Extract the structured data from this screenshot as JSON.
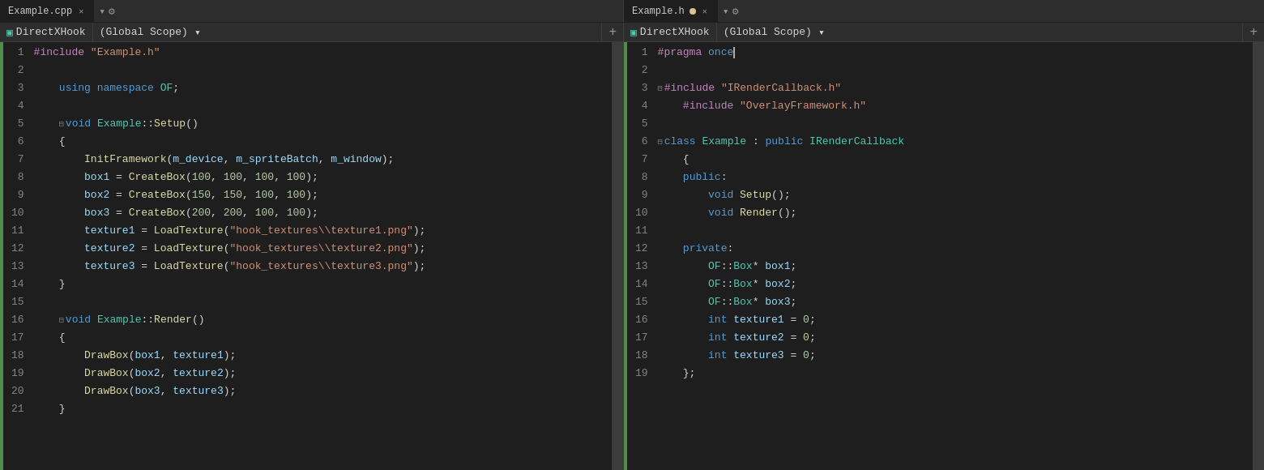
{
  "tabs": {
    "left": {
      "items": [
        {
          "id": "example-cpp",
          "label": "Example.cpp",
          "active": false,
          "modified": false,
          "closable": true
        },
        {
          "id": "settings-gear",
          "label": "⚙",
          "active": false
        }
      ],
      "active_tab": "example-cpp",
      "scope_label": "DirectXHook",
      "scope_select": "(Global Scope)",
      "plus_label": "+"
    },
    "right": {
      "items": [
        {
          "id": "example-h",
          "label": "Example.h",
          "active": true,
          "modified": true,
          "closable": true
        }
      ],
      "scope_label": "DirectXHook",
      "scope_select": "(Global Scope)",
      "plus_label": "+"
    }
  },
  "left_panel": {
    "lines": [
      {
        "num": 1,
        "code": "#include \"Example.h\"",
        "type": "include"
      },
      {
        "num": 2,
        "code": "",
        "type": "blank"
      },
      {
        "num": 3,
        "code": "    using namespace OF;",
        "type": "code"
      },
      {
        "num": 4,
        "code": "",
        "type": "blank"
      },
      {
        "num": 5,
        "code": "    −void Example::Setup()",
        "type": "code"
      },
      {
        "num": 6,
        "code": "    {",
        "type": "code"
      },
      {
        "num": 7,
        "code": "        InitFramework(m_device, m_spriteBatch, m_window);",
        "type": "code"
      },
      {
        "num": 8,
        "code": "        box1 = CreateBox(100, 100, 100, 100);",
        "type": "code"
      },
      {
        "num": 9,
        "code": "        box2 = CreateBox(150, 150, 100, 100);",
        "type": "code"
      },
      {
        "num": 10,
        "code": "        box3 = CreateBox(200, 200, 100, 100);",
        "type": "code"
      },
      {
        "num": 11,
        "code": "        texture1 = LoadTexture(\"hook_textures\\\\texture1.png\");",
        "type": "code"
      },
      {
        "num": 12,
        "code": "        texture2 = LoadTexture(\"hook_textures\\\\texture2.png\");",
        "type": "code"
      },
      {
        "num": 13,
        "code": "        texture3 = LoadTexture(\"hook_textures\\\\texture3.png\");",
        "type": "code"
      },
      {
        "num": 14,
        "code": "    }",
        "type": "code"
      },
      {
        "num": 15,
        "code": "",
        "type": "blank"
      },
      {
        "num": 16,
        "code": "    −void Example::Render()",
        "type": "code"
      },
      {
        "num": 17,
        "code": "    {",
        "type": "code"
      },
      {
        "num": 18,
        "code": "        DrawBox(box1, texture1);",
        "type": "code"
      },
      {
        "num": 19,
        "code": "        DrawBox(box2, texture2);",
        "type": "code"
      },
      {
        "num": 20,
        "code": "        DrawBox(box3, texture3);",
        "type": "code"
      },
      {
        "num": 21,
        "code": "    }",
        "type": "code"
      }
    ]
  },
  "right_panel": {
    "lines": [
      {
        "num": 1,
        "code": "#pragma once",
        "type": "pragma"
      },
      {
        "num": 2,
        "code": "",
        "type": "blank"
      },
      {
        "num": 3,
        "code": "−#include \"IRenderCallback.h\"",
        "type": "include"
      },
      {
        "num": 4,
        "code": "    #include \"OverlayFramework.h\"",
        "type": "include"
      },
      {
        "num": 5,
        "code": "",
        "type": "blank"
      },
      {
        "num": 6,
        "code": "−class Example : public IRenderCallback",
        "type": "class"
      },
      {
        "num": 7,
        "code": "    {",
        "type": "code"
      },
      {
        "num": 8,
        "code": "    public:",
        "type": "code"
      },
      {
        "num": 9,
        "code": "        void Setup();",
        "type": "code"
      },
      {
        "num": 10,
        "code": "        void Render();",
        "type": "code"
      },
      {
        "num": 11,
        "code": "",
        "type": "blank"
      },
      {
        "num": 12,
        "code": "    private:",
        "type": "code"
      },
      {
        "num": 13,
        "code": "        OF::Box* box1;",
        "type": "code"
      },
      {
        "num": 14,
        "code": "        OF::Box* box2;",
        "type": "code"
      },
      {
        "num": 15,
        "code": "        OF::Box* box3;",
        "type": "code"
      },
      {
        "num": 16,
        "code": "        int texture1 = 0;",
        "type": "code"
      },
      {
        "num": 17,
        "code": "        int texture2 = 0;",
        "type": "code"
      },
      {
        "num": 18,
        "code": "        int texture3 = 0;",
        "type": "code"
      },
      {
        "num": 19,
        "code": "    };",
        "type": "code"
      }
    ]
  }
}
